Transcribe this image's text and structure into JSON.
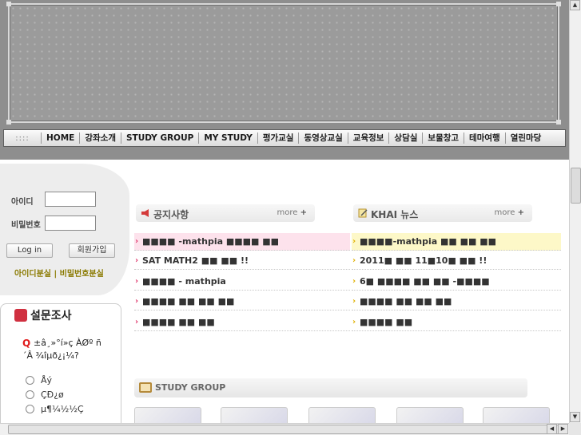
{
  "nav": {
    "grip": "::::",
    "items": [
      "HOME",
      "강좌소개",
      "STUDY GROUP",
      "MY STUDY",
      "평가교실",
      "동영상교실",
      "교육정보",
      "상담실",
      "보물창고",
      "테마여행",
      "열린마당"
    ]
  },
  "login": {
    "id_label": "아이디",
    "pw_label": "비밀번호",
    "login_button": "Log in",
    "join_button": "회원가입",
    "find_links": "아이디분실 | 비밀번호분실"
  },
  "survey": {
    "title": "설문조사",
    "qmark": "Q",
    "question": "±â¸»°í»ç ÀØº ñ´Â ¾îµð¿¡¼?",
    "options": [
      "Åý",
      "ÇÐ¿ø",
      "µ¶¼½½Ç"
    ]
  },
  "notice": {
    "title": "공지사항",
    "more": "more",
    "rows": [
      "■■■■ -mathpia ■■■■ ■■",
      "SAT MATH2 ■■ ■■ !!",
      "■■■■  - mathpia",
      "■■■■ ■■ ■■ ■■",
      "■■■■ ■■ ■■"
    ]
  },
  "news": {
    "title": "KHAI 뉴스",
    "more": "more",
    "rows": [
      "■■■■-mathpia ■■ ■■ ■■",
      "2011■ ■■ 11■10■ ■■ !!",
      "6■ ■■■■ ■■ ■■ -■■■■",
      "■■■■ ■■ ■■ ■■",
      "■■■■ ■■"
    ]
  },
  "study_group": {
    "title": "STUDY GROUP"
  },
  "colors": {
    "nav_bg": "#e8e8e8",
    "banner": "#9b9b9b",
    "notice_highlight": "#fde2ec",
    "news_highlight": "#fdf8c8",
    "accent_red": "#e01b1b"
  }
}
